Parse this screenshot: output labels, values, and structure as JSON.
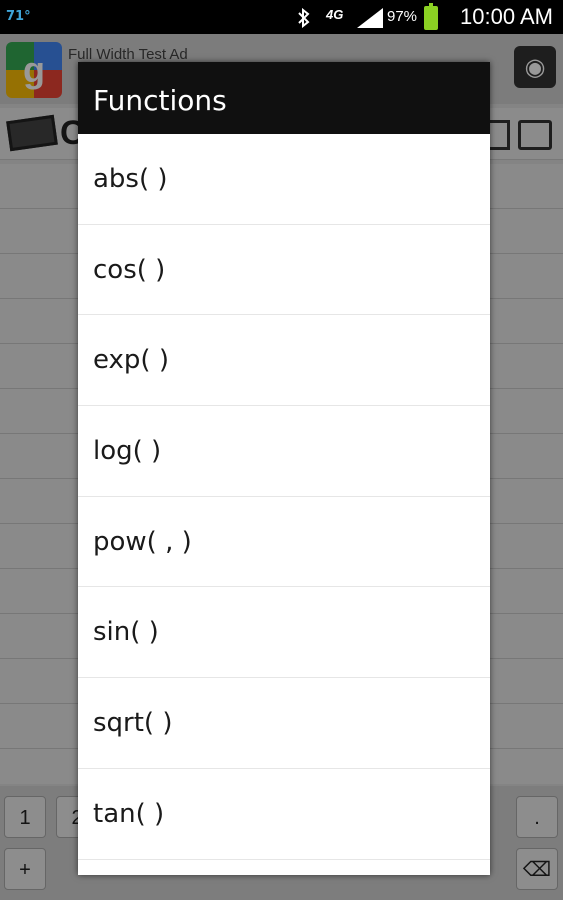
{
  "status_bar": {
    "temperature": "71°",
    "network": "4G",
    "battery_percent": "97%",
    "time": "10:00 AM",
    "battery_level": 0.97,
    "battery_color": "#8bd123"
  },
  "ad": {
    "logo_letter": "g",
    "text": "Full Width Test Ad",
    "globe_icon": "globe-icon"
  },
  "app": {
    "title_fragment": "C"
  },
  "keypad": {
    "row1": [
      "1",
      "2",
      "."
    ],
    "row2": [
      "+",
      "⌫"
    ]
  },
  "dialog": {
    "title": "Functions",
    "items": [
      "abs( )",
      "cos( )",
      "exp( )",
      "log( )",
      "pow( , )",
      "sin( )",
      "sqrt( )",
      "tan( )"
    ]
  }
}
